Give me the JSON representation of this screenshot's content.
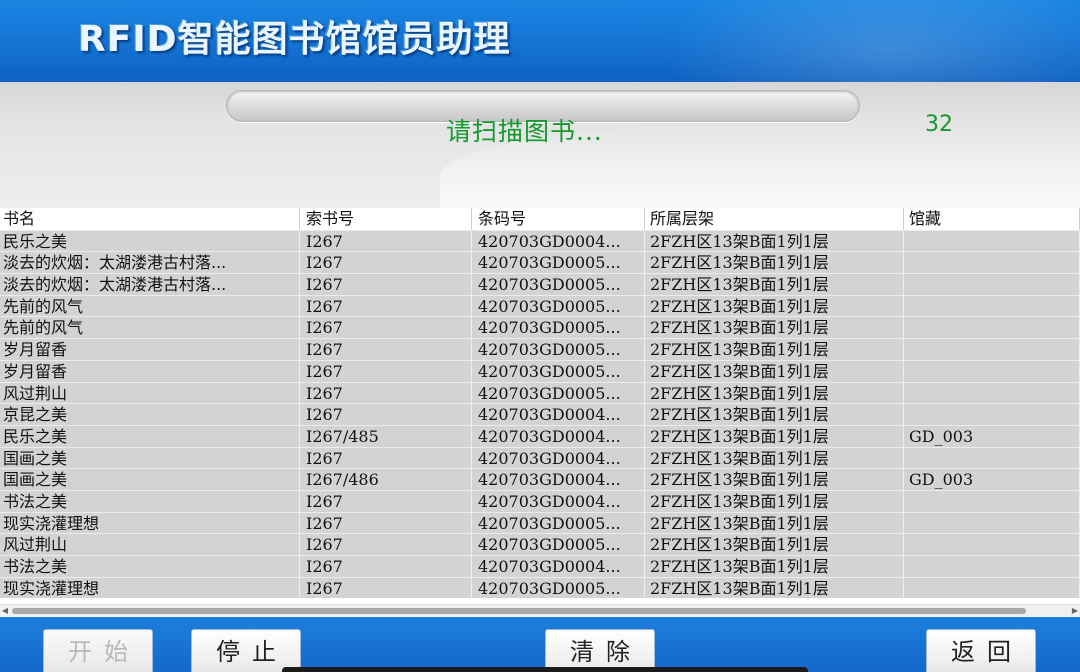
{
  "app": {
    "title": "RFID智能图书馆馆员助理"
  },
  "status": {
    "message": "请扫描图书...",
    "count": "32"
  },
  "table": {
    "headers": [
      "书名",
      "索书号",
      "条码号",
      "所属层架",
      "馆藏"
    ],
    "rows": [
      [
        "民乐之美",
        "I267",
        "420703GD0004...",
        "2FZH区13架B面1列1层",
        ""
      ],
      [
        "淡去的炊烟：太湖溇港古村落...",
        "I267",
        "420703GD0005...",
        "2FZH区13架B面1列1层",
        ""
      ],
      [
        "淡去的炊烟：太湖溇港古村落...",
        "I267",
        "420703GD0005...",
        "2FZH区13架B面1列1层",
        ""
      ],
      [
        "先前的风气",
        "I267",
        "420703GD0005...",
        "2FZH区13架B面1列1层",
        ""
      ],
      [
        "先前的风气",
        "I267",
        "420703GD0005...",
        "2FZH区13架B面1列1层",
        ""
      ],
      [
        "岁月留香",
        "I267",
        "420703GD0005...",
        "2FZH区13架B面1列1层",
        ""
      ],
      [
        "岁月留香",
        "I267",
        "420703GD0005...",
        "2FZH区13架B面1列1层",
        ""
      ],
      [
        "风过荆山",
        "I267",
        "420703GD0005...",
        "2FZH区13架B面1列1层",
        ""
      ],
      [
        "京昆之美",
        "I267",
        "420703GD0004...",
        "2FZH区13架B面1列1层",
        ""
      ],
      [
        "民乐之美",
        "I267/485",
        "420703GD0004...",
        "2FZH区13架B面1列1层",
        "GD_003"
      ],
      [
        "国画之美",
        "I267",
        "420703GD0004...",
        "2FZH区13架B面1列1层",
        ""
      ],
      [
        "国画之美",
        "I267/486",
        "420703GD0004...",
        "2FZH区13架B面1列1层",
        "GD_003"
      ],
      [
        "书法之美",
        "I267",
        "420703GD0004...",
        "2FZH区13架B面1列1层",
        ""
      ],
      [
        "现实浇灌理想",
        "I267",
        "420703GD0005...",
        "2FZH区13架B面1列1层",
        ""
      ],
      [
        "风过荆山",
        "I267",
        "420703GD0005...",
        "2FZH区13架B面1列1层",
        ""
      ],
      [
        "书法之美",
        "I267",
        "420703GD0004...",
        "2FZH区13架B面1列1层",
        ""
      ],
      [
        "现实浇灌理想",
        "I267",
        "420703GD0005...",
        "2FZH区13架B面1列1层",
        ""
      ]
    ]
  },
  "scrollbar": {
    "left_icon": "arrow-left-icon",
    "right_icon": "arrow-right-icon"
  },
  "buttons": {
    "start": "开始",
    "stop": "停止",
    "clear": "清除",
    "back": "返回"
  }
}
